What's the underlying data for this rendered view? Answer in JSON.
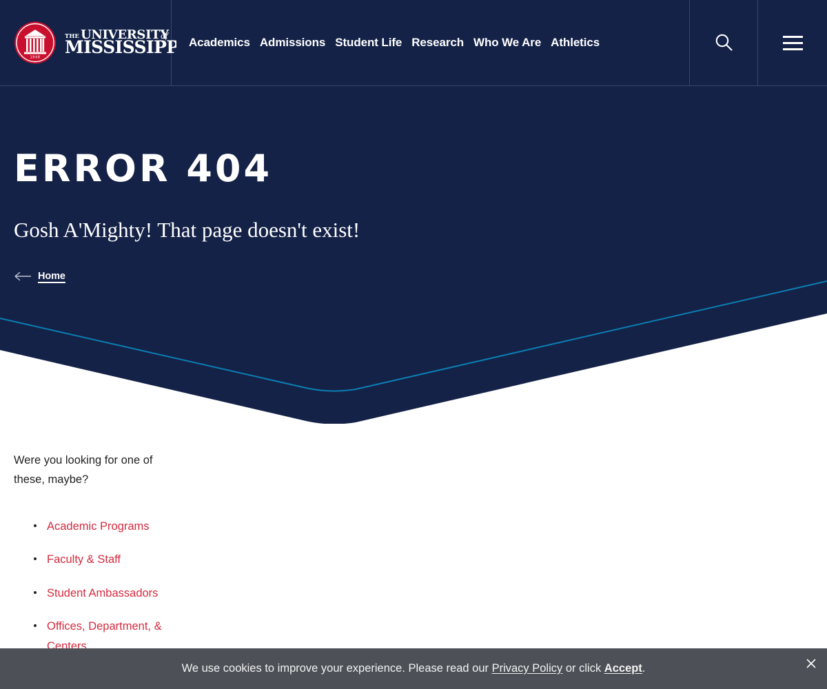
{
  "header": {
    "logo": {
      "name": "university-of-mississippi-logo",
      "line1_small": "THE",
      "line1_main": "UNIVERSITY",
      "line1_of": "of",
      "line2": "MISSISSIPPI",
      "seal_year": "1848",
      "seal_color": "#c8102e"
    },
    "nav_items": [
      {
        "label": "Academics"
      },
      {
        "label": "Admissions"
      },
      {
        "label": "Student Life"
      },
      {
        "label": "Research"
      },
      {
        "label": "Who We Are"
      },
      {
        "label": "Athletics"
      }
    ],
    "search_icon": "search-icon",
    "menu_icon": "hamburger-menu-icon",
    "background_color": "#142247"
  },
  "hero": {
    "title": "ERROR 404",
    "subtitle": "Gosh A'Mighty! That page doesn't exist!",
    "home_link": {
      "label": "Home",
      "arrow_icon": "arrow-left-icon"
    },
    "background_color": "#142247",
    "accent_line_color": "#0b7fb4"
  },
  "main": {
    "intro": "Were you looking for one of these, maybe?",
    "suggestions": [
      {
        "label": "Academic Programs"
      },
      {
        "label": "Faculty & Staff"
      },
      {
        "label": "Student Ambassadors"
      },
      {
        "label": "Offices, Department, & Centers"
      }
    ],
    "link_color": "#d32b3f"
  },
  "cookie_banner": {
    "text_before": "We use cookies to improve your experience. Please read our ",
    "privacy_link": "Privacy Policy",
    "text_middle": " or click ",
    "accept_link": "Accept",
    "text_after": ".",
    "close_icon": "close-icon",
    "background_color": "#4d5157"
  }
}
